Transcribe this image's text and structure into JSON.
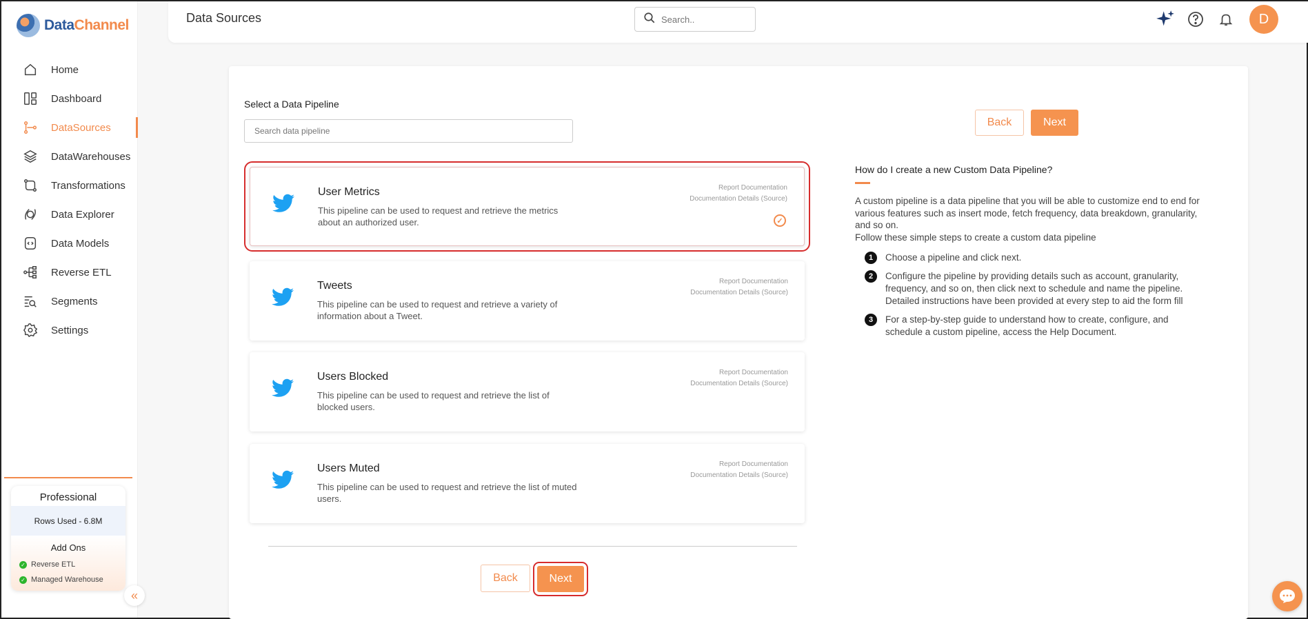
{
  "brand": {
    "name_part1": "Data",
    "name_part2": "Channel"
  },
  "sidebar": {
    "items": [
      {
        "label": "Home",
        "icon": "home-icon"
      },
      {
        "label": "Dashboard",
        "icon": "dashboard-icon"
      },
      {
        "label": "DataSources",
        "icon": "datasources-icon",
        "active": true
      },
      {
        "label": "DataWarehouses",
        "icon": "layers-icon"
      },
      {
        "label": "Transformations",
        "icon": "transform-icon"
      },
      {
        "label": "Data Explorer",
        "icon": "explorer-icon"
      },
      {
        "label": "Data Models",
        "icon": "models-icon"
      },
      {
        "label": "Reverse ETL",
        "icon": "reverse-etl-icon"
      },
      {
        "label": "Segments",
        "icon": "segments-icon"
      },
      {
        "label": "Settings",
        "icon": "gear-icon"
      }
    ]
  },
  "plan": {
    "name": "Professional",
    "rows_used": "Rows Used - 6.8M",
    "addons_title": "Add Ons",
    "addons": [
      "Reverse ETL",
      "Managed Warehouse"
    ]
  },
  "header": {
    "title": "Data Sources",
    "search_placeholder": "Search..",
    "avatar_letter": "D"
  },
  "main": {
    "select_label": "Select a Data Pipeline",
    "pipeline_search_placeholder": "Search data pipeline",
    "back_label": "Back",
    "next_label": "Next",
    "pipelines": [
      {
        "title": "User Metrics",
        "desc": "This pipeline can be used to request and retrieve the metrics about an authorized user.",
        "doc1": "Report Documentation",
        "doc2": "Documentation Details (Source)",
        "selected": true
      },
      {
        "title": "Tweets",
        "desc": "This pipeline can be used to request and retrieve a variety of information about a Tweet.",
        "doc1": "Report Documentation",
        "doc2": "Documentation Details (Source)"
      },
      {
        "title": "Users Blocked",
        "desc": "This pipeline can be used to request and retrieve the list of blocked users.",
        "doc1": "Report Documentation",
        "doc2": "Documentation Details (Source)"
      },
      {
        "title": "Users Muted",
        "desc": "This pipeline can be used to request and retrieve the list of muted users.",
        "doc1": "Report Documentation",
        "doc2": "Documentation Details (Source)"
      }
    ]
  },
  "help": {
    "title": "How do I create a new Custom Data Pipeline?",
    "para1": "A custom pipeline is a data pipeline that you will be able to customize end to end for various features such as insert mode, fetch frequency, data breakdown, granularity, and so on.",
    "para2": "Follow these simple steps to create a custom data pipeline",
    "steps": [
      {
        "n": "1",
        "text": "Choose a pipeline and click next."
      },
      {
        "n": "2",
        "text": "Configure the pipeline by providing details such as account, granularity, frequency, and so on, then click next to schedule and name the pipeline. Detailed instructions have been provided at every step to aid the form fill"
      },
      {
        "n": "3",
        "text": "For a step-by-step guide to understand how to create, configure, and schedule a custom pipeline, access the Help Document."
      }
    ]
  },
  "colors": {
    "accent": "#f28a4c",
    "brand_blue": "#2d5a9c",
    "twitter": "#1da1f2"
  }
}
